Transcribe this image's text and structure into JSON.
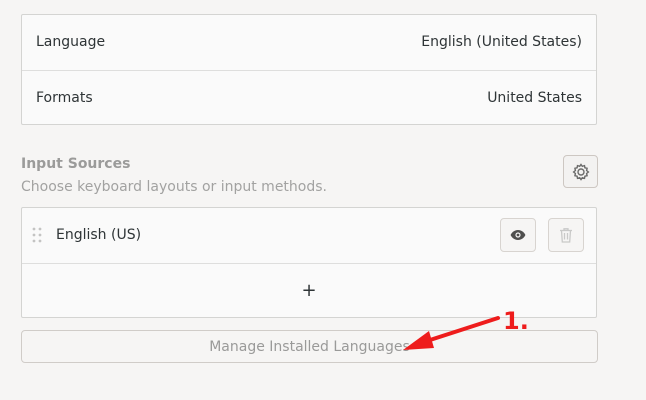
{
  "region_settings": {
    "language_label": "Language",
    "language_value": "English (United States)",
    "formats_label": "Formats",
    "formats_value": "United States"
  },
  "input_sources": {
    "title": "Input Sources",
    "subtitle": "Choose keyboard layouts or input methods.",
    "items": [
      {
        "label": "English (US)"
      }
    ],
    "add_glyph": "+"
  },
  "manage_button_label": "Manage Installed Languages",
  "annotation": {
    "label": "1.",
    "color": "#ee1c1c"
  },
  "icons": {
    "gear": "gear-icon",
    "eye": "eye-icon",
    "trash": "trash-icon",
    "drag": "drag-handle-icon",
    "plus": "plus-icon"
  }
}
